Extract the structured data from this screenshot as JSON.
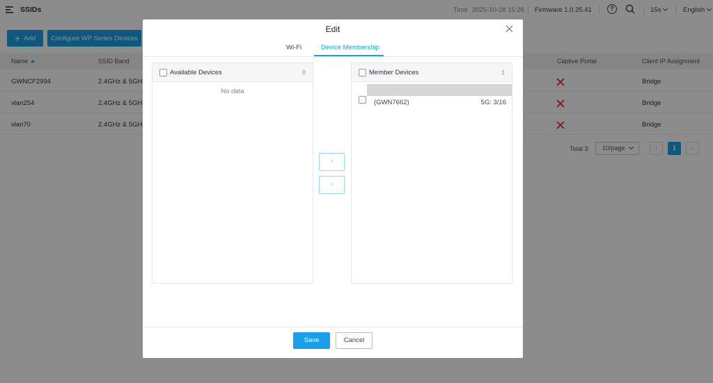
{
  "header": {
    "title": "SSIDs",
    "time_label": "Time",
    "time_value": "2025-10-28 15:26",
    "firmware": "Firmware 1.0.25.41",
    "refresh": "15s",
    "language": "English"
  },
  "toolbar": {
    "add_plus": "+",
    "add_label": "Add",
    "configure_label": "Configure WP Series Devices"
  },
  "table": {
    "columns": {
      "name": "Name",
      "ssid_band": "SSID Band",
      "captive_portal": "Captive Portal",
      "client_ip": "Client IP Assignment"
    },
    "rows": [
      {
        "name": "GWNCF2994",
        "band": "2.4GHz & 5GHz",
        "captive_portal": "x-icon",
        "client_ip": "Bridge"
      },
      {
        "name": "vlan254",
        "band": "2.4GHz & 5GHz",
        "captive_portal": "x-icon",
        "client_ip": "Bridge"
      },
      {
        "name": "vlan70",
        "band": "2.4GHz & 5GHz",
        "captive_portal": "x-icon",
        "client_ip": "Bridge"
      }
    ]
  },
  "pagination": {
    "total": "Total 3",
    "page_size": "10/page",
    "prev": "‹",
    "current": "1",
    "next": "›"
  },
  "modal": {
    "title": "Edit",
    "tabs": [
      "Wi-Fi",
      "Device Membership"
    ],
    "active_tab": "Device Membership",
    "available": {
      "title": "Available Devices",
      "count": "0",
      "empty_text": "No data"
    },
    "member": {
      "title": "Member Devices",
      "count": "1",
      "devices": [
        {
          "name": "(GWN7662)",
          "radio": "5G: 3/16"
        }
      ]
    },
    "move_left": "‹",
    "move_right": "›",
    "save_label": "Save",
    "cancel_label": "Cancel"
  },
  "colors": {
    "accent": "#1aa0e8",
    "danger": "#e53935"
  }
}
